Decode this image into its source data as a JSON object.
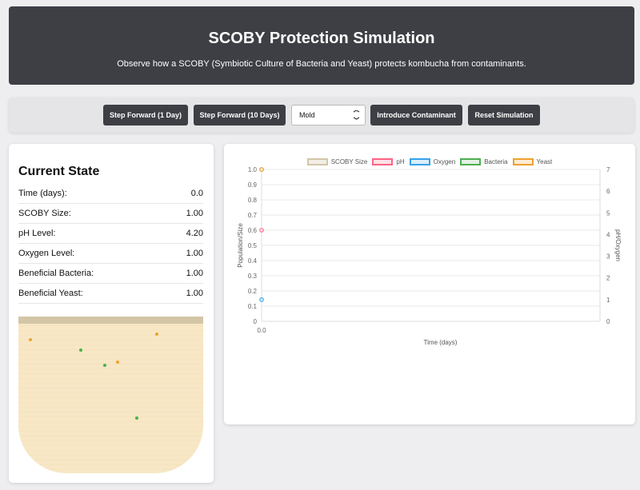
{
  "header": {
    "title": "SCOBY Protection Simulation",
    "subtitle": "Observe how a SCOBY (Symbiotic Culture of Bacteria and Yeast) protects kombucha from contaminants."
  },
  "controls": {
    "step1_label": "Step Forward (1 Day)",
    "step10_label": "Step Forward (10 Days)",
    "contaminant_selected": "Mold",
    "introduce_label": "Introduce Contaminant",
    "reset_label": "Reset Simulation"
  },
  "state": {
    "title": "Current State",
    "rows": [
      {
        "label": "Time (days):",
        "value": "0.0"
      },
      {
        "label": "SCOBY Size:",
        "value": "1.00"
      },
      {
        "label": "pH Level:",
        "value": "4.20"
      },
      {
        "label": "Oxygen Level:",
        "value": "1.00"
      },
      {
        "label": "Beneficial Bacteria:",
        "value": "1.00"
      },
      {
        "label": "Beneficial Yeast:",
        "value": "1.00"
      }
    ]
  },
  "colors": {
    "scoby": "#d3c6a7",
    "ph": "#ff6384",
    "oxygen": "#36a2eb",
    "bacteria": "#4caf50",
    "yeast": "#f0a030"
  },
  "chart_data": {
    "type": "line",
    "xlabel": "Time (days)",
    "ylabel_left": "Population/Size",
    "ylabel_right": "pH/Oxygen",
    "x": [
      0.0
    ],
    "x_tick_labels": [
      "0.0"
    ],
    "ylim_left": [
      0,
      1.0
    ],
    "ylim_right": [
      0,
      7
    ],
    "y_ticks_left": [
      "0",
      "0.1",
      "0.2",
      "0.3",
      "0.4",
      "0.5",
      "0.6",
      "0.7",
      "0.8",
      "0.9",
      "1.0"
    ],
    "y_ticks_right": [
      "0",
      "1",
      "2",
      "3",
      "4",
      "5",
      "6",
      "7"
    ],
    "legend_position": "top",
    "series": [
      {
        "name": "SCOBY Size",
        "axis": "left",
        "values": [
          1.0
        ],
        "color": "#c9bd95"
      },
      {
        "name": "pH",
        "axis": "right",
        "values": [
          4.2
        ],
        "color": "#ff6384"
      },
      {
        "name": "Oxygen",
        "axis": "right",
        "values": [
          1.0
        ],
        "color": "#36a2eb"
      },
      {
        "name": "Bacteria",
        "axis": "left",
        "values": [
          1.0
        ],
        "color": "#4caf50"
      },
      {
        "name": "Yeast",
        "axis": "left",
        "values": [
          1.0
        ],
        "color": "#f0a030"
      }
    ]
  }
}
